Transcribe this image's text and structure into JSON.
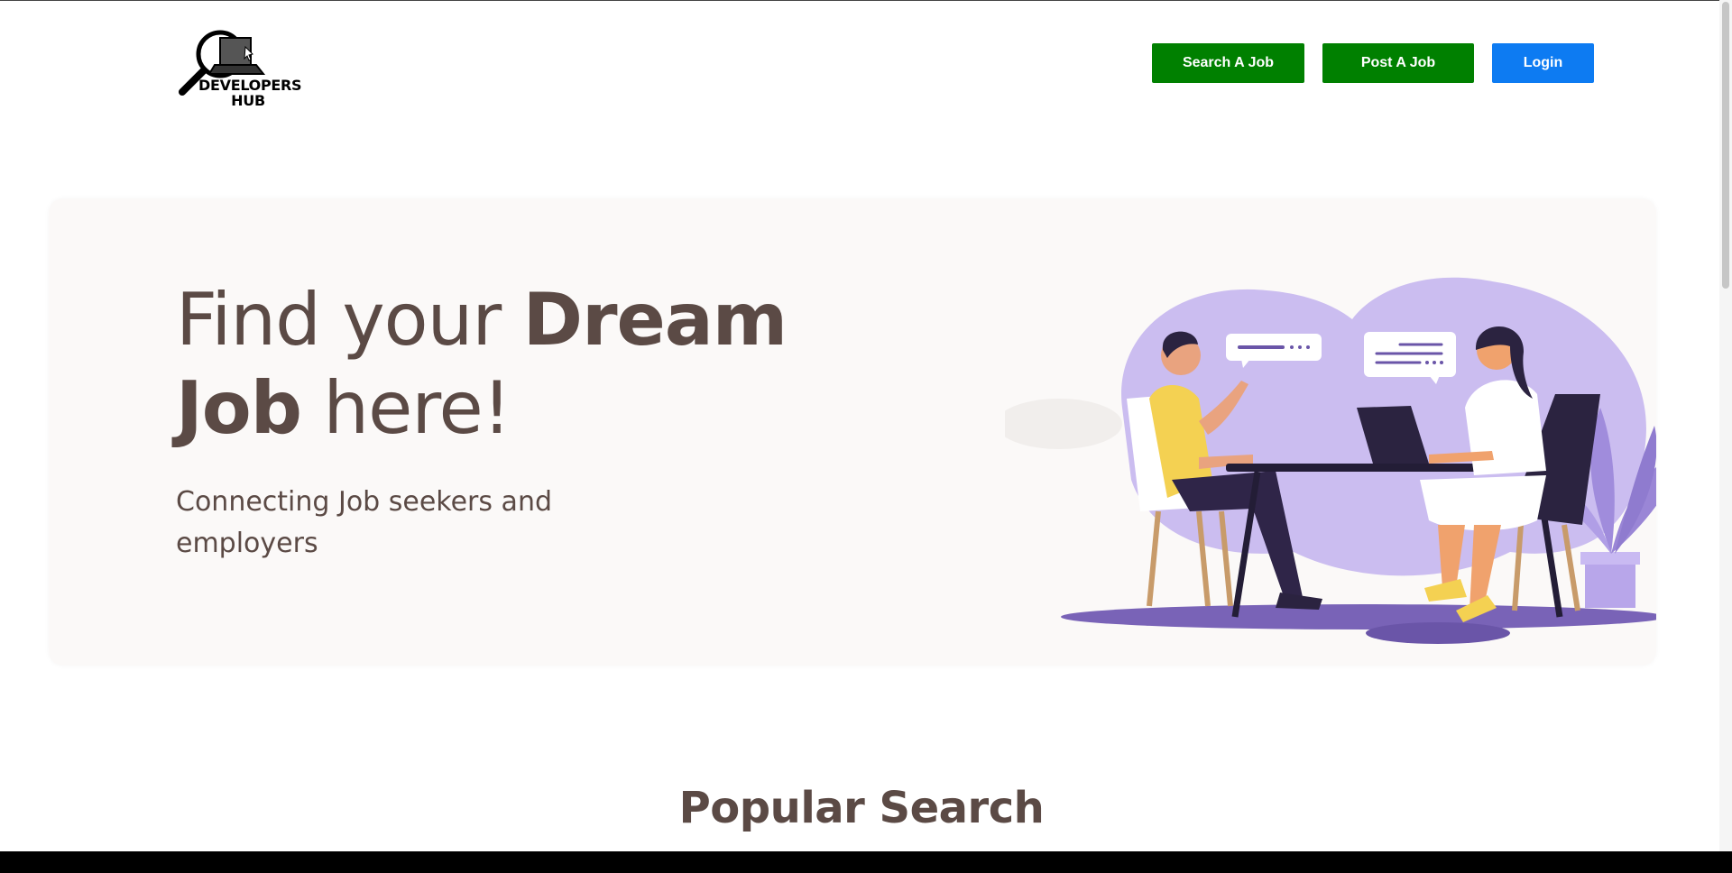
{
  "header": {
    "logo_text_line1": "DEVELOPERS",
    "logo_text_line2": "HUB",
    "nav": {
      "search_label": "Search A Job",
      "post_label": "Post A Job",
      "login_label": "Login"
    }
  },
  "hero": {
    "title_part1": "Find your ",
    "title_bold1": "Dream",
    "title_bold2": "Job",
    "title_part2": " here!",
    "subtitle": "Connecting Job seekers and employers",
    "illustration": "two-people-interview-illustration"
  },
  "sections": {
    "popular_title": "Popular Search"
  },
  "colors": {
    "nav_green": "#008000",
    "login_blue": "#0d7bf2",
    "text_brown": "#5b4a45",
    "hero_bg": "#fbf9f8",
    "blob_purple": "#cbbdf0"
  }
}
